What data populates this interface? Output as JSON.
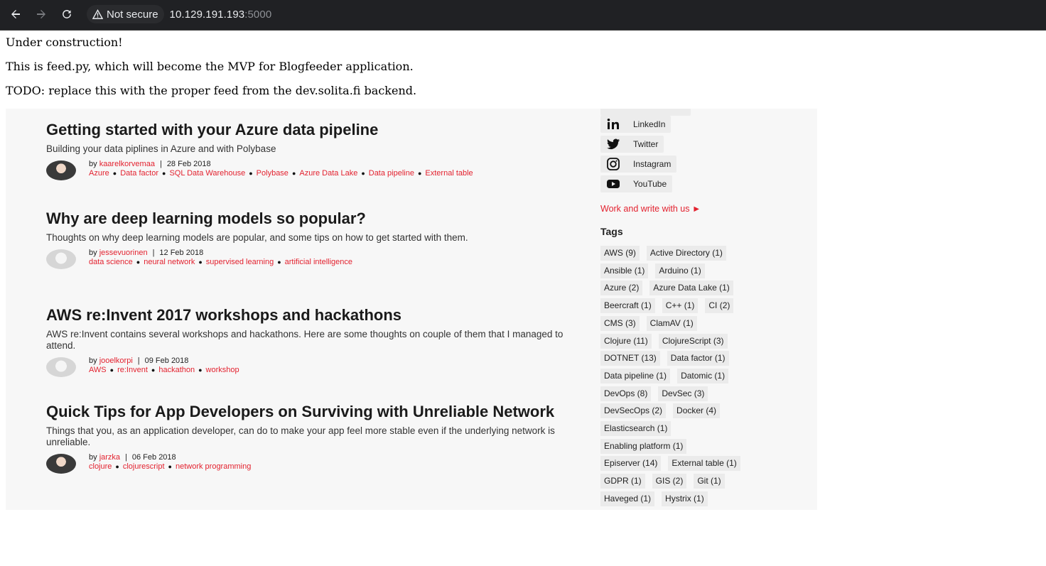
{
  "browser": {
    "security_label": "Not secure",
    "url_host": "10.129.191.193",
    "url_port": ":5000"
  },
  "page": {
    "line1": "Under construction!",
    "line2": "This is feed.py, which will become the MVP for Blogfeeder application.",
    "line3": "TODO: replace this with the proper feed from the dev.solita.fi backend."
  },
  "feed": {
    "posts": [
      {
        "title": "Getting started with your Azure data pipeline",
        "subtitle": "Building your data piplines in Azure and with Polybase",
        "by": "by",
        "author": "kaarelkorvemaa",
        "date": "28 Feb 2018",
        "tags": [
          "Azure",
          "Data factor",
          "SQL Data Warehouse",
          "Polybase",
          "Azure Data Lake",
          "Data pipeline",
          "External table"
        ]
      },
      {
        "title": "Why are deep learning models so popular?",
        "subtitle": "Thoughts on why deep learning models are popular, and some tips on how to get started with them.",
        "by": "by",
        "author": "jessevuorinen",
        "date": "12 Feb 2018",
        "tags": [
          "data science",
          "neural network",
          "supervised learning",
          "artificial intelligence"
        ]
      },
      {
        "title": "AWS re:Invent 2017 workshops and hackathons",
        "subtitle": "AWS re:Invent contains several workshops and hackathons. Here are some thoughts on couple of them that I managed to attend.",
        "by": "by",
        "author": "jooelkorpi",
        "date": "09 Feb 2018",
        "tags": [
          "AWS",
          "re:Invent",
          "hackathon",
          "workshop"
        ]
      },
      {
        "title": "Quick Tips for App Developers on Surviving with Unreliable Network",
        "subtitle": "Things that you, as an application developer, can do to make your app feel more stable even if the underlying network is unreliable.",
        "by": "by",
        "author": "jarzka",
        "date": "06 Feb 2018",
        "tags": [
          "clojure",
          "clojurescript",
          "network programming"
        ]
      }
    ]
  },
  "sidebar": {
    "social": [
      {
        "label": "LinkedIn",
        "icon": "linkedin-icon"
      },
      {
        "label": "Twitter",
        "icon": "twitter-icon"
      },
      {
        "label": "Instagram",
        "icon": "instagram-icon"
      },
      {
        "label": "YouTube",
        "icon": "youtube-icon"
      }
    ],
    "work_link": "Work and write with us ►",
    "tags_heading": "Tags",
    "tag_rows": [
      [
        "AWS (9)",
        "Active Directory (1)"
      ],
      [
        "Ansible (1)",
        "Arduino (1)"
      ],
      [
        "Azure (2)",
        "Azure Data Lake (1)"
      ],
      [
        "Beercraft (1)",
        "C++ (1)",
        "CI (2)"
      ],
      [
        "CMS (3)",
        "ClamAV (1)"
      ],
      [
        "Clojure (11)",
        "ClojureScript (3)"
      ],
      [
        "DOTNET (13)",
        "Data factor (1)"
      ],
      [
        "Data pipeline (1)",
        "Datomic (1)"
      ],
      [
        "DevOps (8)",
        "DevSec (3)"
      ],
      [
        "DevSecOps (2)",
        "Docker (4)"
      ],
      [
        "Elasticsearch (1)"
      ],
      [
        "Enabling platform (1)"
      ],
      [
        "Episerver (14)",
        "External table (1)"
      ],
      [
        "GDPR (1)",
        "GIS (2)",
        "Git (1)"
      ],
      [
        "Haveged (1)",
        "Hystrix (1)"
      ]
    ]
  }
}
